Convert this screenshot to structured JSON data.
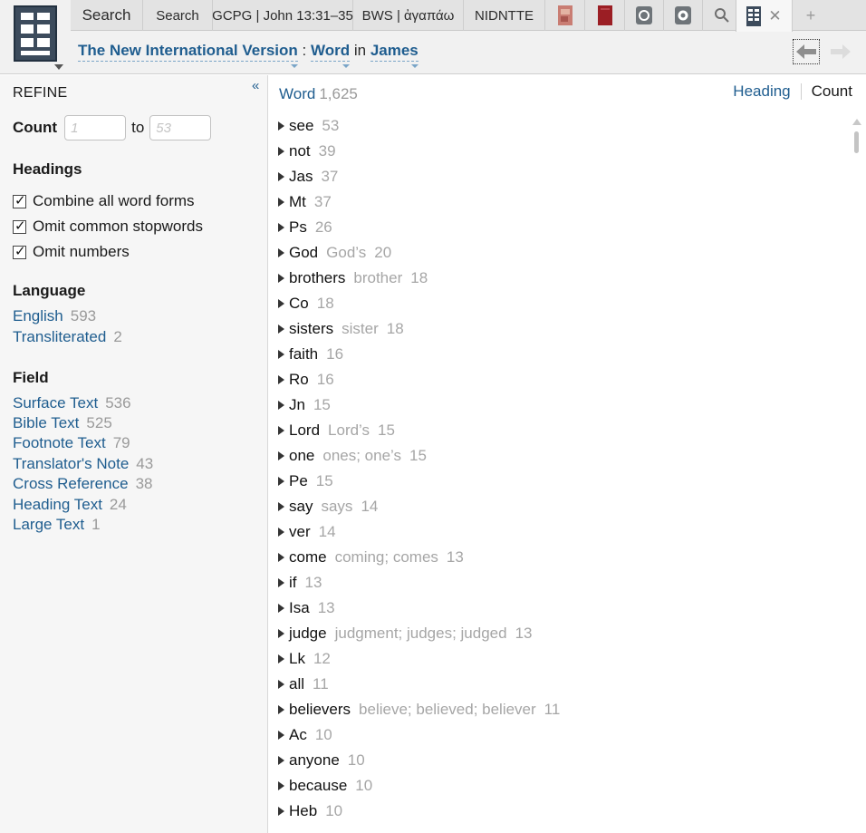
{
  "tabs": [
    {
      "label": "Search",
      "kind": "text"
    },
    {
      "label": "Search",
      "kind": "text"
    },
    {
      "label": "GCPG | John 13:31–35",
      "kind": "text"
    },
    {
      "label": "BWS | ἀγαπάω",
      "kind": "text"
    },
    {
      "label": "NIDNTTE",
      "kind": "text"
    },
    {
      "icon": "red-book-cover-icon",
      "kind": "icon"
    },
    {
      "icon": "dark-red-book-icon",
      "kind": "icon"
    },
    {
      "icon": "circle-gear-icon",
      "kind": "icon"
    },
    {
      "icon": "seal-gear-icon",
      "kind": "icon"
    },
    {
      "icon": "search-icon",
      "kind": "icon"
    },
    {
      "icon": "bible-word-study-icon",
      "kind": "active"
    },
    {
      "icon": "new-tab-plus-icon",
      "kind": "plus"
    }
  ],
  "breadcrumb": {
    "resource": "The New International Version",
    "sep": ":",
    "field": "Word",
    "in_label": "in",
    "scope": "James"
  },
  "sidebar": {
    "title": "REFINE",
    "collapse": "«",
    "count": {
      "label": "Count",
      "to": "to",
      "min_placeholder": "1",
      "max_placeholder": "53"
    },
    "headings": {
      "title": "Headings",
      "options": [
        {
          "label": "Combine all word forms",
          "checked": true
        },
        {
          "label": "Omit common stopwords",
          "checked": true
        },
        {
          "label": "Omit numbers",
          "checked": true
        }
      ]
    },
    "language": {
      "title": "Language",
      "items": [
        {
          "name": "English",
          "count": "593"
        },
        {
          "name": "Transliterated",
          "count": "2"
        }
      ]
    },
    "field": {
      "title": "Field",
      "items": [
        {
          "name": "Surface Text",
          "count": "536"
        },
        {
          "name": "Bible Text",
          "count": "525"
        },
        {
          "name": "Footnote Text",
          "count": "79"
        },
        {
          "name": "Translator's Note",
          "count": "43"
        },
        {
          "name": "Cross Reference",
          "count": "38"
        },
        {
          "name": "Heading Text",
          "count": "24"
        },
        {
          "name": "Large Text",
          "count": "1"
        }
      ]
    }
  },
  "main": {
    "title": "Word",
    "total": "1,625",
    "sort_heading": "Heading",
    "sort_count": "Count",
    "words": [
      {
        "word": "see",
        "forms": "",
        "count": "53"
      },
      {
        "word": "not",
        "forms": "",
        "count": "39"
      },
      {
        "word": "Jas",
        "forms": "",
        "count": "37"
      },
      {
        "word": "Mt",
        "forms": "",
        "count": "37"
      },
      {
        "word": "Ps",
        "forms": "",
        "count": "26"
      },
      {
        "word": "God",
        "forms": "God’s",
        "count": "20"
      },
      {
        "word": "brothers",
        "forms": "brother",
        "count": "18"
      },
      {
        "word": "Co",
        "forms": "",
        "count": "18"
      },
      {
        "word": "sisters",
        "forms": "sister",
        "count": "18"
      },
      {
        "word": "faith",
        "forms": "",
        "count": "16"
      },
      {
        "word": "Ro",
        "forms": "",
        "count": "16"
      },
      {
        "word": "Jn",
        "forms": "",
        "count": "15"
      },
      {
        "word": "Lord",
        "forms": "Lord’s",
        "count": "15"
      },
      {
        "word": "one",
        "forms": "ones; one’s",
        "count": "15"
      },
      {
        "word": "Pe",
        "forms": "",
        "count": "15"
      },
      {
        "word": "say",
        "forms": "says",
        "count": "14"
      },
      {
        "word": "ver",
        "forms": "",
        "count": "14"
      },
      {
        "word": "come",
        "forms": "coming; comes",
        "count": "13"
      },
      {
        "word": "if",
        "forms": "",
        "count": "13"
      },
      {
        "word": "Isa",
        "forms": "",
        "count": "13"
      },
      {
        "word": "judge",
        "forms": "judgment; judges; judged",
        "count": "13"
      },
      {
        "word": "Lk",
        "forms": "",
        "count": "12"
      },
      {
        "word": "all",
        "forms": "",
        "count": "11"
      },
      {
        "word": "believers",
        "forms": "believe; believed; believer",
        "count": "11"
      },
      {
        "word": "Ac",
        "forms": "",
        "count": "10"
      },
      {
        "word": "anyone",
        "forms": "",
        "count": "10"
      },
      {
        "word": "because",
        "forms": "",
        "count": "10"
      },
      {
        "word": "Heb",
        "forms": "",
        "count": "10"
      }
    ]
  },
  "colors": {
    "link": "#1f5d8f",
    "muted": "#9a9a9a",
    "app_icon": "#3c4b5c"
  }
}
